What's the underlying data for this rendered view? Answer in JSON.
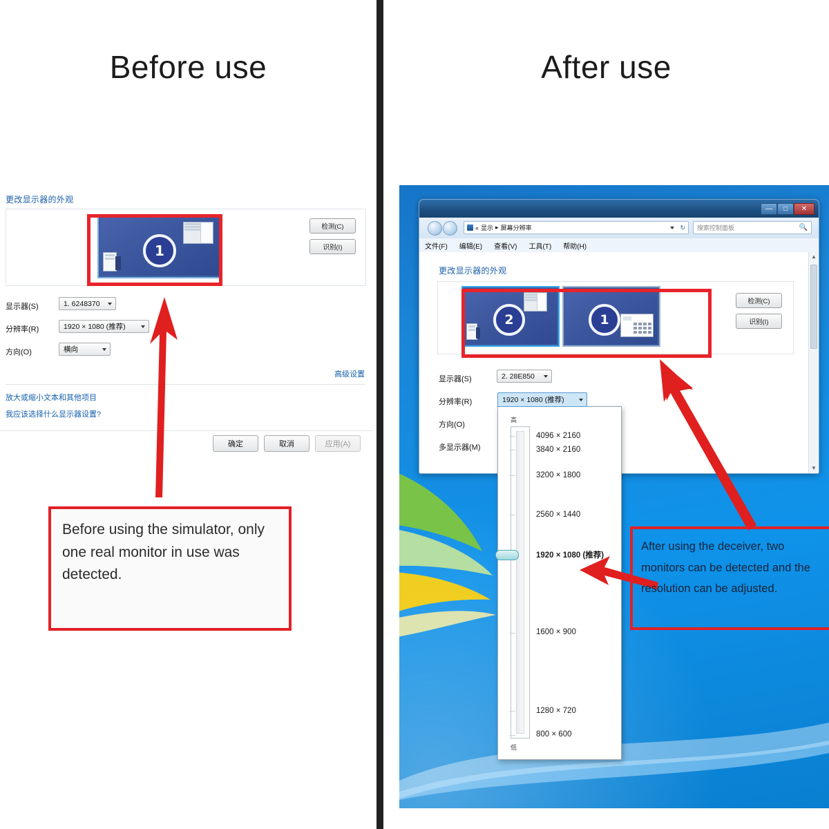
{
  "panels": {
    "left_title": "Before use",
    "right_title": "After use"
  },
  "left_dialog": {
    "heading": "更改显示器的外观",
    "detect_button": "检测(C)",
    "identify_button": "识别(I)",
    "monitor_number": "1",
    "fields": [
      {
        "label": "显示器(S)",
        "value": "1. 6248370"
      },
      {
        "label": "分辨率(R)",
        "value": "1920 × 1080 (推荐)"
      },
      {
        "label": "方向(O)",
        "value": "横向"
      }
    ],
    "advanced_link": "高级设置",
    "links": [
      "放大或缩小文本和其他项目",
      "我应该选择什么显示器设置?"
    ],
    "buttons": {
      "ok": "确定",
      "cancel": "取消",
      "apply": "应用(A)"
    }
  },
  "right_window": {
    "breadcrumb_root": "显示",
    "breadcrumb_leaf": "屏幕分辨率",
    "search_placeholder": "搜索控制面板",
    "menu": [
      "文件(F)",
      "编辑(E)",
      "查看(V)",
      "工具(T)",
      "帮助(H)"
    ],
    "window_controls": {
      "minimize": "—",
      "maximize": "□",
      "close": "✕"
    },
    "heading": "更改显示器的外观",
    "detect_button": "检测(C)",
    "identify_button": "识别(I)",
    "monitors": [
      {
        "number": "2",
        "selected": true
      },
      {
        "number": "1",
        "selected": false
      }
    ],
    "fields": [
      {
        "label": "显示器(S)",
        "value": "2. 28E850"
      },
      {
        "label": "分辨率(R)",
        "value": "1920 × 1080 (推荐)"
      },
      {
        "label": "方向(O)",
        "value": ""
      },
      {
        "label": "多显示器(M)",
        "value": ""
      }
    ],
    "resolution_dropdown": {
      "selected": "1920 × 1080 (推荐)",
      "high_label": "高",
      "low_label": "低",
      "options": [
        "4096 × 2160",
        "3840 × 2160",
        "3200 × 1800",
        "2560 × 1440",
        "1920 × 1080 (推荐)",
        "1600 × 900",
        "1280 × 720",
        "800 × 600"
      ]
    }
  },
  "captions": {
    "left": "Before using the simulator, only one real monitor in use was detected.",
    "right": "After using the deceiver, two monitors can be detected and the resolution can be adjusted."
  },
  "colors": {
    "highlight_red": "#e02127",
    "arrow_red": "#e01f1f",
    "desktop_blue": "#0f93ea",
    "link_blue": "#1560ac",
    "title_bar_blue": "#1d4f82"
  }
}
